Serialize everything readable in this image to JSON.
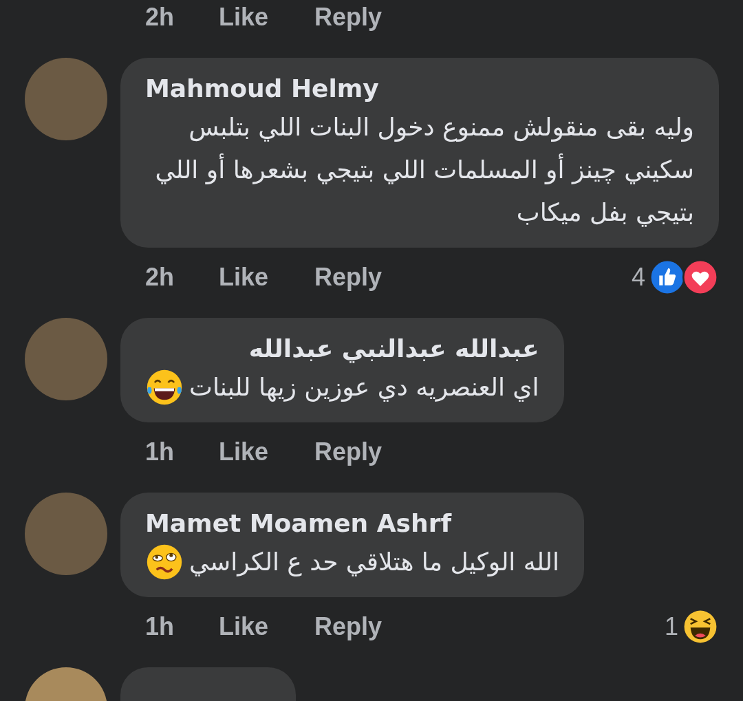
{
  "previous_meta": {
    "time": "2h",
    "like": "Like",
    "reply": "Reply"
  },
  "comments": [
    {
      "author": "Mahmoud Helmy",
      "text": "وليه بقى منقولش ممنوع دخول البنات اللي بتلبس سكيني چينز أو المسلمات اللي بتيجي بشعرها أو اللي بتيجي بفل ميكاب",
      "time": "2h",
      "like": "Like",
      "reply": "Reply",
      "reaction_count": "4",
      "reactions": [
        {
          "kind": "like"
        },
        {
          "kind": "love"
        }
      ]
    },
    {
      "author": "عبدالله عبدالنبي عبدالله",
      "text": "اي العنصريه دي عوزين زيها للبنات",
      "emoji": {
        "kind": "laugh-tears"
      },
      "time": "1h",
      "like": "Like",
      "reply": "Reply"
    },
    {
      "author": "Mamet Moamen Ashrf",
      "text": "الله الوكيل ما هتلاقي حد ع الكراسي",
      "emoji": {
        "kind": "woozy"
      },
      "time": "1h",
      "like": "Like",
      "reply": "Reply",
      "reaction_count": "1",
      "reactions": [
        {
          "kind": "haha"
        }
      ]
    }
  ]
}
